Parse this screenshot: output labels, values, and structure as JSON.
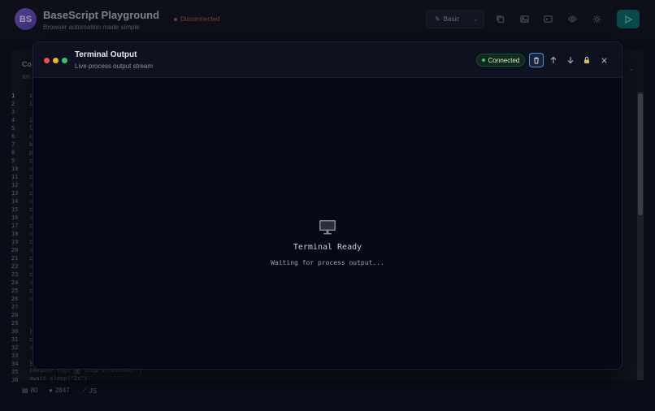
{
  "app": {
    "avatar": "BS",
    "title": "BaseScript Playground",
    "subtitle": "Browser automation made simple",
    "status": "Disconnected",
    "mode": "Basic",
    "header_icons": [
      "copy-icon",
      "image-icon",
      "terminal-icon",
      "eye-icon",
      "sun-icon"
    ],
    "run_icon": "play-icon"
  },
  "editor": {
    "title": "Co",
    "subtitle": "Wri",
    "line_numbers": [
      "1",
      "2",
      "3",
      "4",
      "5",
      "6",
      "7",
      "8",
      "9",
      "10",
      "11",
      "12",
      "13",
      "14",
      "15",
      "16",
      "17",
      "18",
      "19",
      "20",
      "21",
      "22",
      "23",
      "24",
      "25",
      "26",
      "27",
      "28",
      "29",
      "30",
      "31",
      "32",
      "33",
      "34",
      "35",
      "36"
    ],
    "line_starts": [
      "i",
      "i",
      "",
      "i",
      "l",
      "c",
      "b",
      "p",
      "c",
      "a",
      "c",
      "a",
      "c",
      "a",
      "c",
      "a",
      "c",
      "a",
      "c",
      "a",
      "c",
      "a",
      "c",
      "a",
      "c",
      "a",
      "",
      "",
      "",
      "}",
      "c",
      "a",
      "",
      "}"
    ],
    "line35": "console.log(\"📷 Step screenshot\")",
    "line36": "await sleep(\"2s\")"
  },
  "status_bar": {
    "lines": "80",
    "chars": "2847",
    "language": "JS"
  },
  "terminal": {
    "title": "Terminal Output",
    "subtitle": "Live process output stream",
    "status": "Connected",
    "ready_title": "Terminal Ready",
    "ready_subtitle": "Waiting for process output...",
    "colors": {
      "red": "#ef4f47",
      "yellow": "#f0b429",
      "green": "#3ac46a"
    }
  }
}
